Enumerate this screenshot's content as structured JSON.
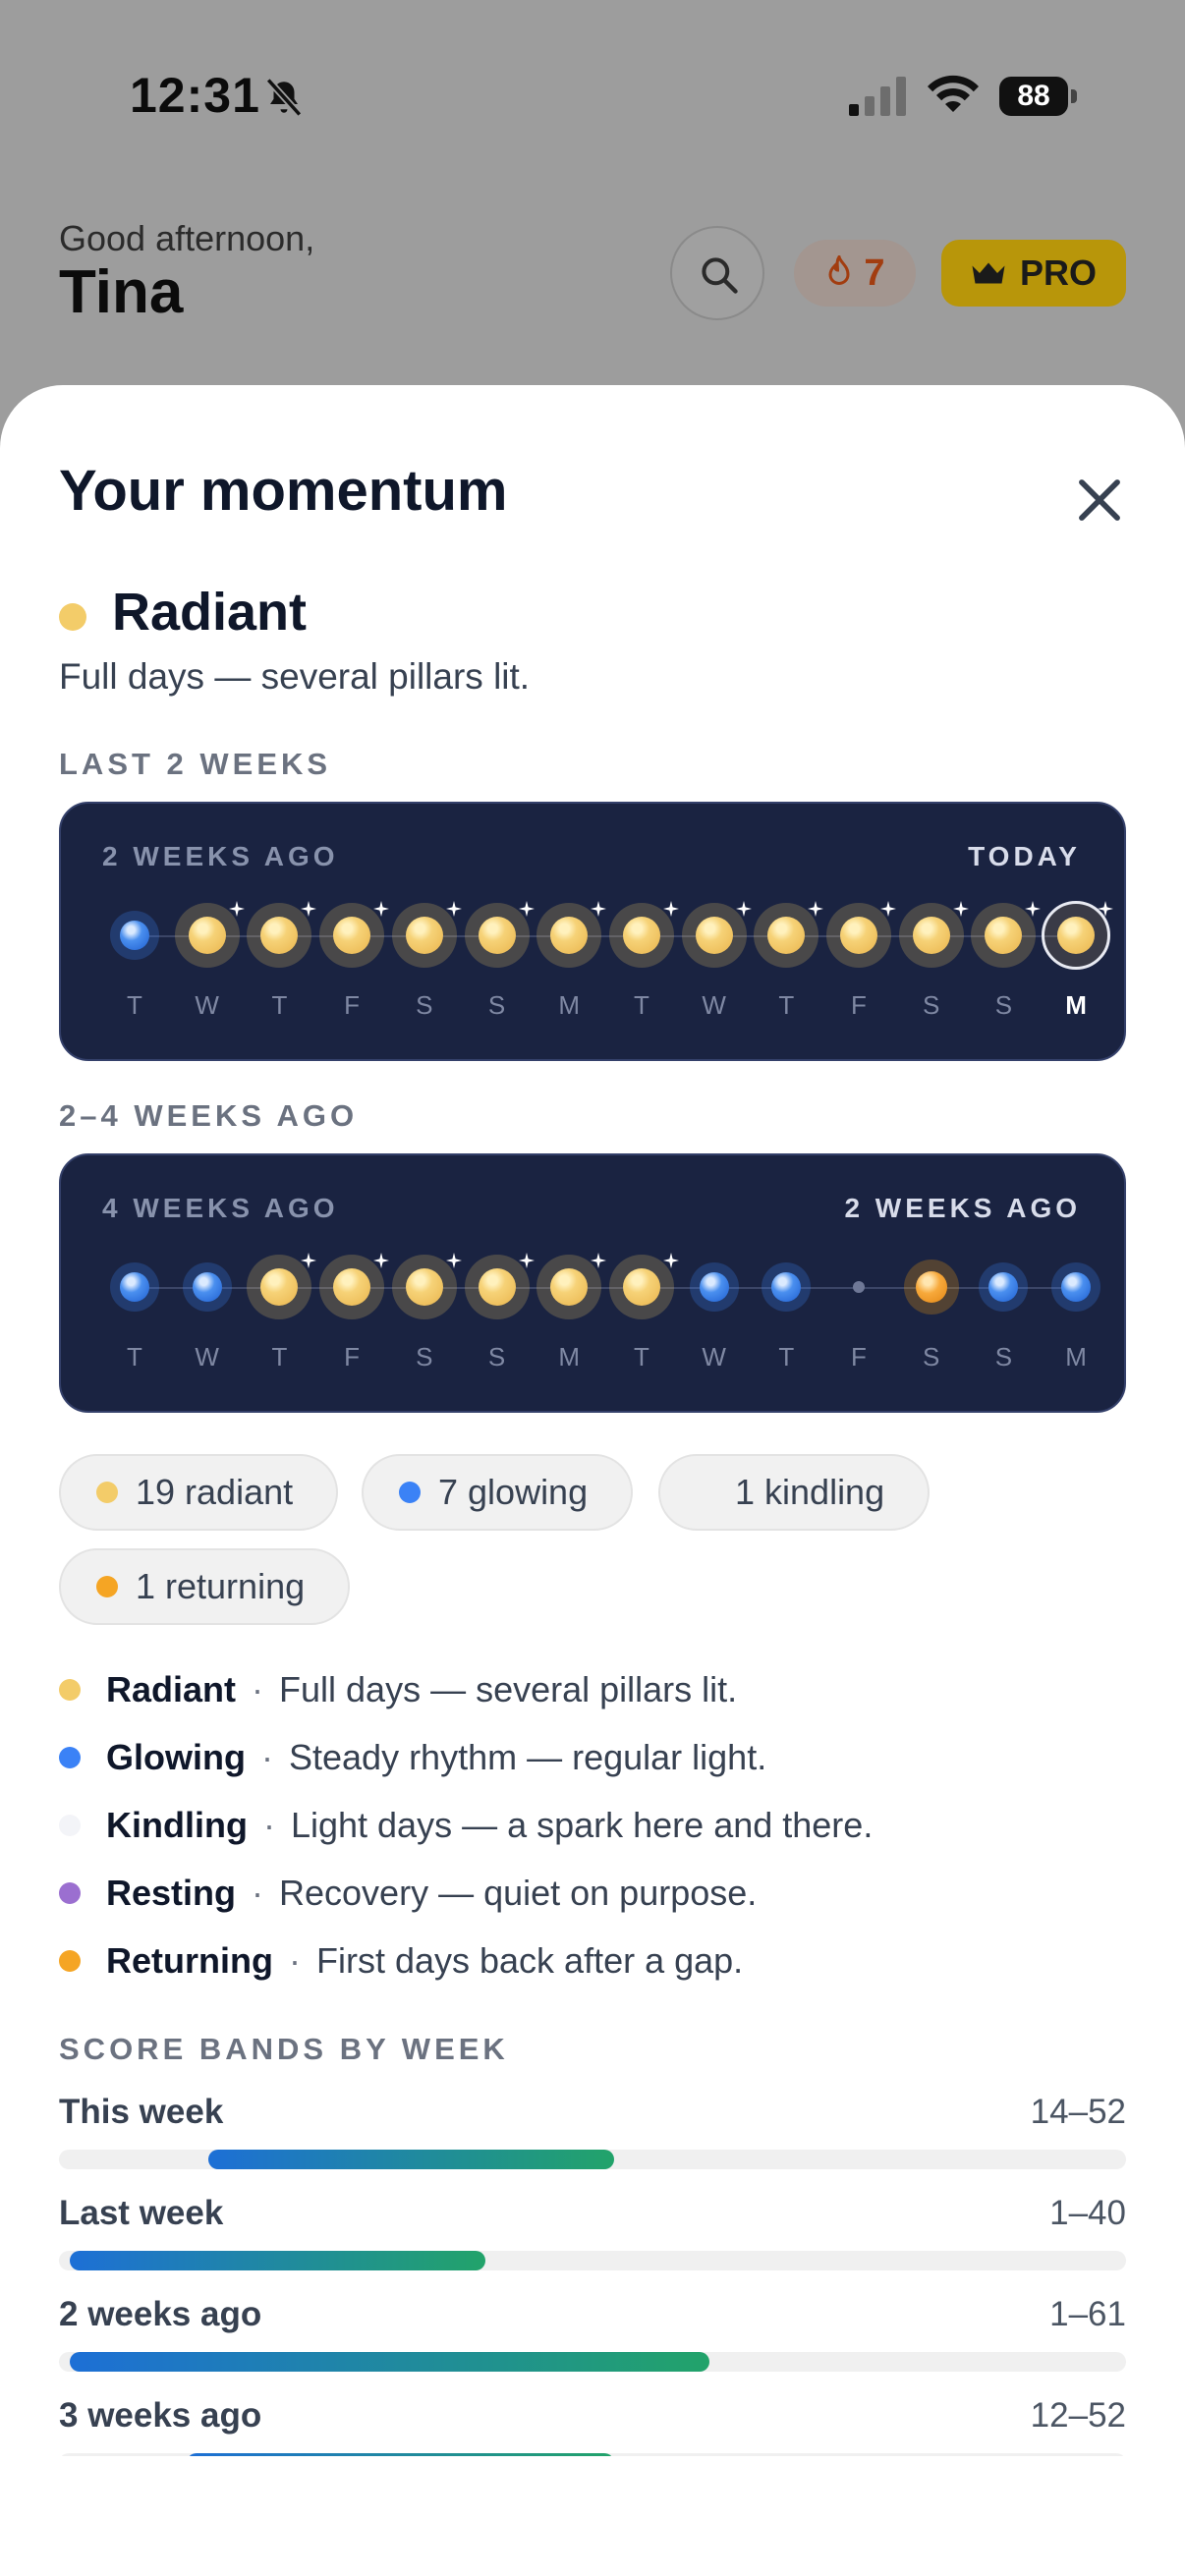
{
  "status_bar": {
    "time": "12:31",
    "battery": "88"
  },
  "header": {
    "greeting": "Good afternoon,",
    "name": "Tina",
    "streak_count": "7",
    "pro_label": "PRO"
  },
  "sheet": {
    "title": "Your momentum",
    "current_tier": {
      "name": "Radiant",
      "description": "Full days — several pillars lit.",
      "color": "#f3cc69"
    },
    "recent": {
      "section_label": "LAST 2 WEEKS",
      "left_label": "2 WEEKS AGO",
      "right_label": "TODAY",
      "days": [
        {
          "letter": "T",
          "state": "glowing"
        },
        {
          "letter": "W",
          "state": "radiant"
        },
        {
          "letter": "T",
          "state": "radiant"
        },
        {
          "letter": "F",
          "state": "radiant"
        },
        {
          "letter": "S",
          "state": "radiant"
        },
        {
          "letter": "S",
          "state": "radiant"
        },
        {
          "letter": "M",
          "state": "radiant"
        },
        {
          "letter": "T",
          "state": "radiant"
        },
        {
          "letter": "W",
          "state": "radiant"
        },
        {
          "letter": "T",
          "state": "radiant"
        },
        {
          "letter": "F",
          "state": "radiant"
        },
        {
          "letter": "S",
          "state": "radiant"
        },
        {
          "letter": "S",
          "state": "radiant"
        },
        {
          "letter": "M",
          "state": "radiant",
          "today": true
        }
      ]
    },
    "older": {
      "section_label": "2–4 WEEKS AGO",
      "left_label": "4 WEEKS AGO",
      "right_label": "2 WEEKS AGO",
      "days": [
        {
          "letter": "T",
          "state": "glowing"
        },
        {
          "letter": "W",
          "state": "glowing"
        },
        {
          "letter": "T",
          "state": "radiant"
        },
        {
          "letter": "F",
          "state": "radiant"
        },
        {
          "letter": "S",
          "state": "radiant"
        },
        {
          "letter": "S",
          "state": "radiant"
        },
        {
          "letter": "M",
          "state": "radiant"
        },
        {
          "letter": "T",
          "state": "radiant"
        },
        {
          "letter": "W",
          "state": "glowing"
        },
        {
          "letter": "T",
          "state": "glowing"
        },
        {
          "letter": "F",
          "state": "kindling"
        },
        {
          "letter": "S",
          "state": "returning"
        },
        {
          "letter": "S",
          "state": "glowing"
        },
        {
          "letter": "M",
          "state": "glowing"
        }
      ]
    },
    "counts": [
      {
        "label": "19 radiant",
        "color": "#f3cc69"
      },
      {
        "label": "7 glowing",
        "color": "#3b82f6"
      },
      {
        "label": "1 kindling",
        "color": "#f1f1f1"
      },
      {
        "label": "1 returning",
        "color": "#f5a524"
      }
    ],
    "legend": [
      {
        "name": "Radiant",
        "description": "Full days — several pillars lit.",
        "color": "#f3cc69"
      },
      {
        "name": "Glowing",
        "description": "Steady rhythm — regular light.",
        "color": "#3b82f6"
      },
      {
        "name": "Kindling",
        "description": "Light days — a spark here and there.",
        "color": "#f3f4f8"
      },
      {
        "name": "Resting",
        "description": "Recovery — quiet on purpose.",
        "color": "#9b6fd0"
      },
      {
        "name": "Returning",
        "description": "First days back after a gap.",
        "color": "#f5a524"
      }
    ],
    "legend_separator": "·",
    "score_bands": {
      "section_label": "SCORE BANDS BY WEEK",
      "scale_max": 100,
      "weeks": [
        {
          "label": "This week",
          "range": "14–52",
          "low": 14,
          "high": 52
        },
        {
          "label": "Last week",
          "range": "1–40",
          "low": 1,
          "high": 40
        },
        {
          "label": "2 weeks ago",
          "range": "1–61",
          "low": 1,
          "high": 61
        },
        {
          "label": "3 weeks ago",
          "range": "12–52",
          "low": 12,
          "high": 52
        }
      ]
    }
  }
}
